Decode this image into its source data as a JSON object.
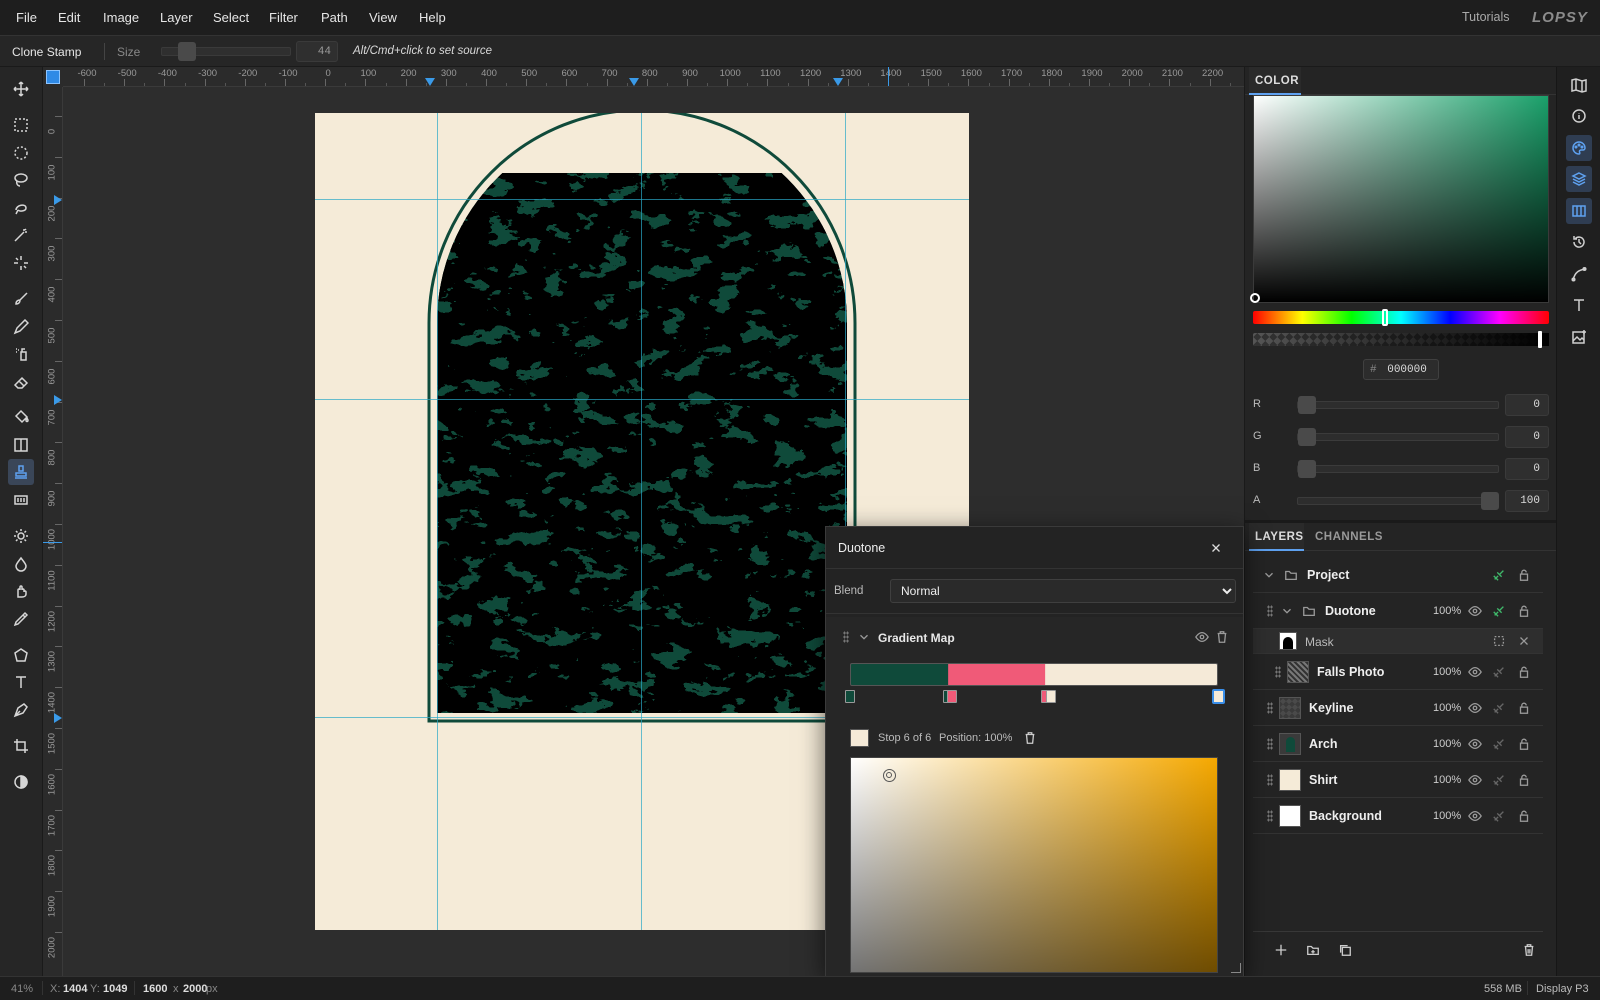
{
  "menu": [
    "File",
    "Edit",
    "Image",
    "Layer",
    "Select",
    "Filter",
    "Path",
    "View",
    "Help"
  ],
  "header": {
    "tutorials": "Tutorials",
    "logo": "LOPSY"
  },
  "options": {
    "tool_name": "Clone Stamp",
    "size_label": "Size",
    "size_value": "44",
    "hint": "Alt/Cmd+click to set source"
  },
  "tools": [
    "move-icon",
    "rect-select-icon",
    "ellipse-select-icon",
    "lasso-icon",
    "magnetic-lasso-icon",
    "magic-wand-icon",
    "quick-select-icon",
    "brush-icon",
    "pencil-icon",
    "spray-icon",
    "eraser-icon",
    "bucket-icon",
    "gradient-icon",
    "clone-stamp-icon",
    "pattern-stamp-icon",
    "dodge-icon",
    "burn-icon",
    "smudge-icon",
    "eyedropper-icon",
    "shape-icon",
    "text-icon",
    "pen-icon",
    "crop-icon",
    "contrast-icon"
  ],
  "ruler": {
    "top": [
      "-600",
      "-500",
      "-400",
      "-300",
      "-200",
      "-100",
      "0",
      "100",
      "200",
      "300",
      "400",
      "500",
      "600",
      "700",
      "800",
      "900",
      "1000",
      "1100",
      "1200",
      "1300",
      "1400",
      "1500",
      "1600",
      "1700",
      "1800",
      "1900",
      "2000",
      "2100",
      "2200"
    ],
    "left": [
      "0",
      "100",
      "200",
      "300",
      "400",
      "500",
      "600",
      "700",
      "800",
      "900",
      "1000",
      "1100",
      "1200",
      "1300",
      "1400",
      "1500",
      "1600",
      "1700",
      "1800",
      "1900",
      "2000"
    ]
  },
  "color_panel": {
    "tab": "COLOR",
    "hex_prefix": "#",
    "hex": "000000",
    "channels": [
      {
        "label": "R",
        "value": "0"
      },
      {
        "label": "G",
        "value": "0"
      },
      {
        "label": "B",
        "value": "0"
      },
      {
        "label": "A",
        "value": "100"
      }
    ],
    "field_hue_color": "#1aa06a"
  },
  "layers_panel": {
    "tabs": [
      "LAYERS",
      "CHANNELS"
    ],
    "rows": [
      {
        "name": "Project",
        "opacity": ""
      },
      {
        "name": "Duotone",
        "opacity": "100%"
      },
      {
        "name": "Mask",
        "opacity": ""
      },
      {
        "name": "Falls Photo",
        "opacity": "100%"
      },
      {
        "name": "Keyline",
        "opacity": "100%"
      },
      {
        "name": "Arch",
        "opacity": "100%"
      },
      {
        "name": "Shirt",
        "opacity": "100%"
      },
      {
        "name": "Background",
        "opacity": "100%"
      }
    ]
  },
  "dialog": {
    "title": "Duotone",
    "blend_label": "Blend",
    "blend_value": "Normal",
    "blend_options": [
      "Normal"
    ],
    "effect": "Gradient Map",
    "stop_info": "Stop 6 of 6",
    "position_info": "Position: 100%",
    "gradient_colors": [
      "#0f4a3a",
      "#f05a78",
      "#f5ead8"
    ],
    "picker_hue": "#f5a800"
  },
  "status": {
    "zoom": "41%",
    "x_label": "X:",
    "x": "1404",
    "y_label": "Y:",
    "y": "1049",
    "w": "1600",
    "times": "x",
    "h": "2000",
    "unit": "px",
    "memory": "558 MB",
    "profile": "Display P3"
  },
  "colors": {
    "accent": "#4a9ae8",
    "artboard": "#f5ebd8",
    "green": "#0f4a3a",
    "pink": "#f05a78",
    "guide": "#2aa8c8"
  }
}
